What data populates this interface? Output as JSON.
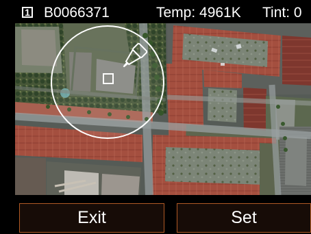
{
  "header": {
    "frame_number": "1",
    "image_id": "B0066371",
    "temperature": "Temp: 4961K",
    "tint": "Tint: 0"
  },
  "tool": {
    "icon": "eyedropper-icon",
    "sample_marker": "sample-point-square"
  },
  "buttons": {
    "exit_label": "Exit",
    "set_label": "Set"
  },
  "colors": {
    "button_border": "#b15a25",
    "button_fill": "#170c07",
    "text": "#ffffff"
  }
}
